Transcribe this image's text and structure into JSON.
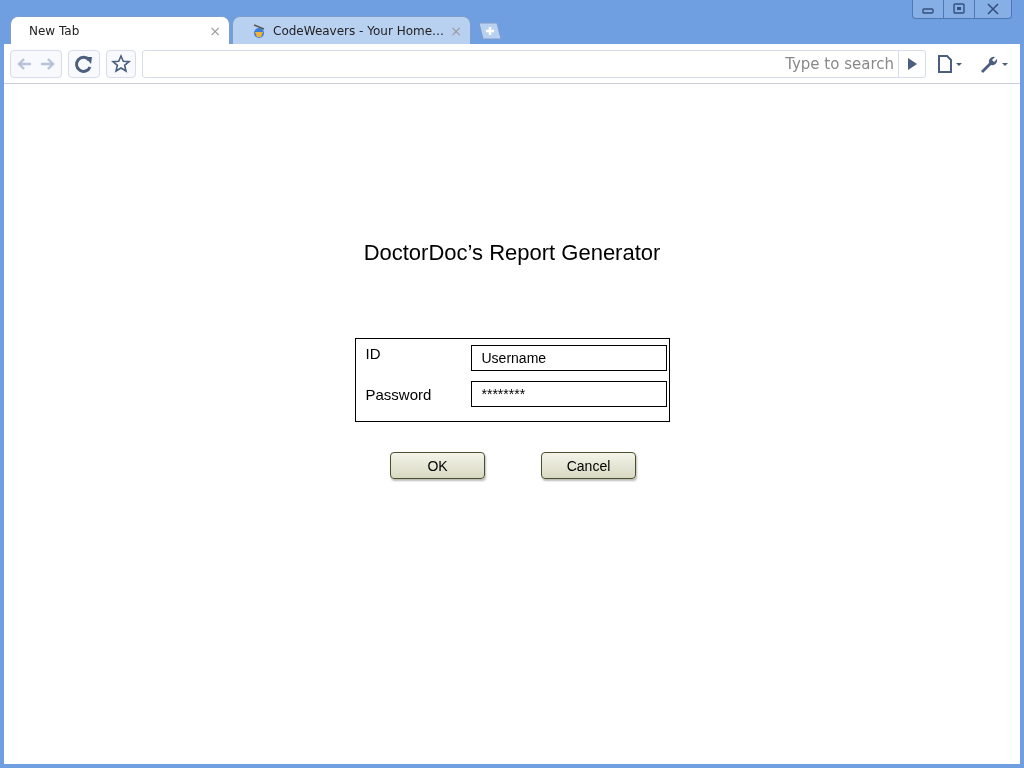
{
  "tabs": [
    {
      "title": "New Tab",
      "close": "×",
      "kind": "blank",
      "selected": true
    },
    {
      "title": "CodeWeavers - Your Home…",
      "close": "×",
      "kind": "site",
      "selected": false
    }
  ],
  "toolbar": {
    "search_placeholder": "Type to search"
  },
  "page": {
    "heading": "DoctorDoc’s Report Generator",
    "fields": [
      {
        "label": "ID",
        "value": "Username"
      },
      {
        "label": "Password",
        "value": "********"
      }
    ],
    "buttons": [
      "OK",
      "Cancel"
    ]
  }
}
